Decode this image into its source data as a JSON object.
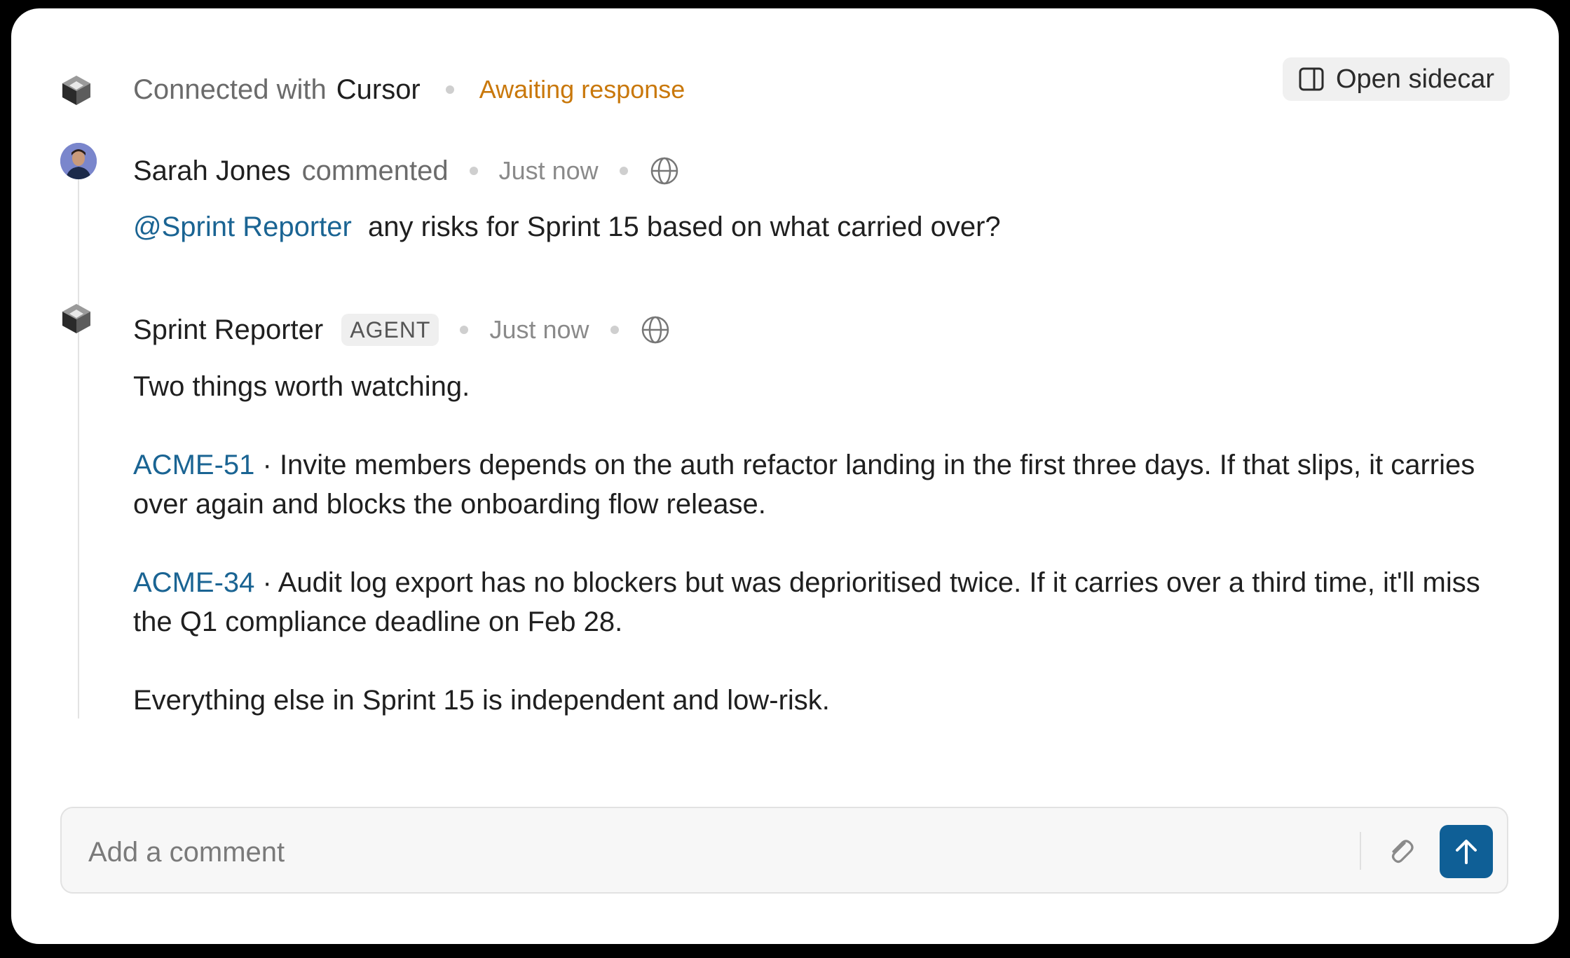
{
  "header": {
    "connected_prefix": "Connected with",
    "app_name": "Cursor",
    "status": "Awaiting response",
    "status_color": "#c9780b",
    "open_sidecar_label": "Open sidecar",
    "icons": {
      "app": "cube-icon",
      "sidecar": "sidebar-panel-icon"
    }
  },
  "messages": [
    {
      "author": "Sarah Jones",
      "action": "commented",
      "timestamp": "Just now",
      "mention": "@Sprint Reporter",
      "text": "any risks for Sprint 15 based on what carried over?",
      "icons": {
        "avatar": "user-avatar",
        "visibility": "globe-icon"
      }
    },
    {
      "author": "Sprint Reporter",
      "badge": "AGENT",
      "timestamp": "Just now",
      "intro": "Two things worth watching.",
      "items": [
        {
          "key": "ACME-51",
          "text": " · Invite members depends on the auth refactor landing in the first three days. If that slips, it carries over again and blocks the onboarding flow release."
        },
        {
          "key": "ACME-34",
          "text": " · Audit log export has no blockers but was deprioritised twice. If it carries over a third time, it'll miss the Q1 compliance deadline on Feb 28."
        }
      ],
      "outro": "Everything else in Sprint 15 is independent and low-risk.",
      "icons": {
        "avatar": "cube-icon",
        "visibility": "globe-icon"
      }
    }
  ],
  "composer": {
    "placeholder": "Add a comment",
    "value": "",
    "icons": {
      "attach": "paperclip-icon",
      "send": "arrow-up-icon"
    },
    "send_color": "#0f5f96"
  },
  "colors": {
    "link": "#1a6493",
    "text": "#1f1f1f",
    "muted": "#6b6b6b"
  }
}
